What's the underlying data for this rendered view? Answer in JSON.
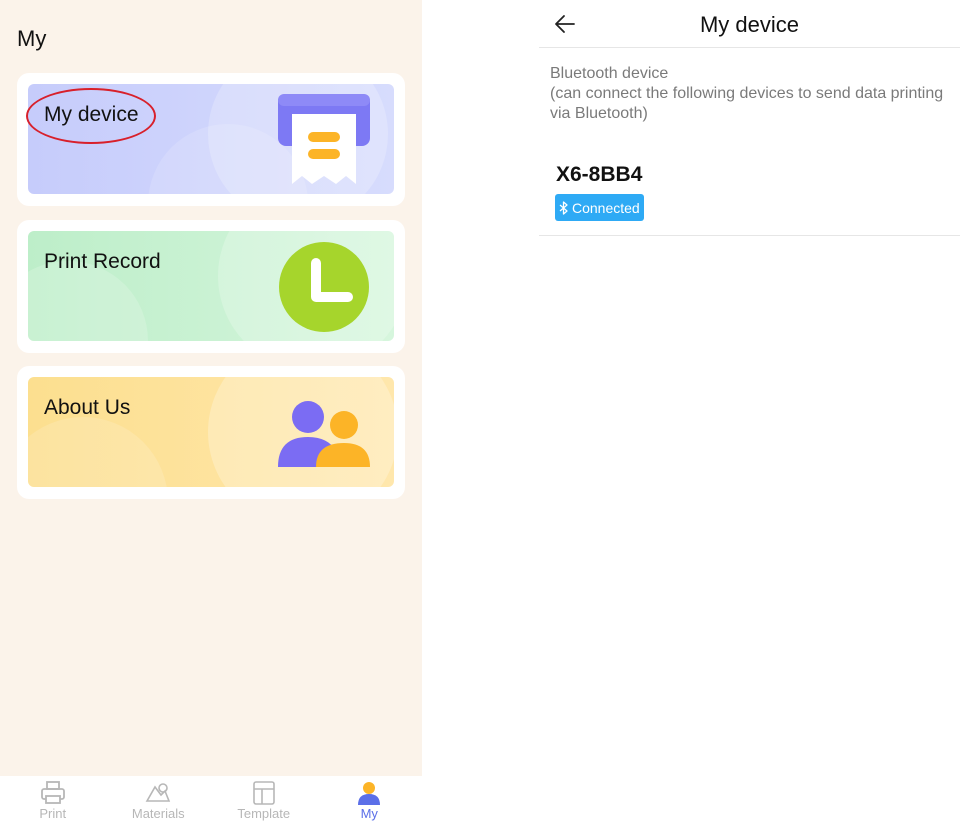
{
  "left": {
    "title": "My",
    "cards": [
      {
        "label": "My device"
      },
      {
        "label": "Print Record"
      },
      {
        "label": "About Us"
      }
    ],
    "nav": [
      {
        "label": "Print",
        "icon": "printer-icon",
        "active": false
      },
      {
        "label": "Materials",
        "icon": "materials-icon",
        "active": false
      },
      {
        "label": "Template",
        "icon": "template-icon",
        "active": false
      },
      {
        "label": "My",
        "icon": "user-icon",
        "active": true
      }
    ]
  },
  "right": {
    "title": "My device",
    "section": {
      "line1": "Bluetooth device",
      "line2": "(can connect the following devices to send data printing via Bluetooth)"
    },
    "device": {
      "name": "X6-8BB4",
      "status": "Connected"
    }
  },
  "colors": {
    "accent_blue": "#5b6fe8",
    "badge_blue": "#2eaaf5",
    "annotation_red": "#d8202b",
    "record_green": "#a6d52c",
    "about_orange": "#fcb427",
    "about_purple": "#7b6cf3"
  }
}
